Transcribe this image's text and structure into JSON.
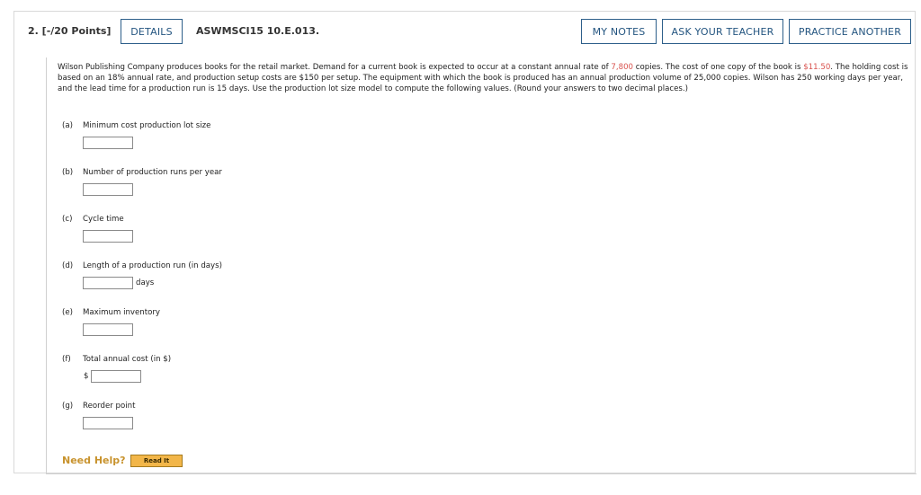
{
  "header": {
    "question_number": "2. [-/20 Points]",
    "details_button": "DETAILS",
    "problem_code": "ASWMSCI15 10.E.013.",
    "my_notes_button": "MY NOTES",
    "ask_teacher_button": "ASK YOUR TEACHER",
    "practice_another_button": "PRACTICE ANOTHER"
  },
  "problem": {
    "text_1": "Wilson Publishing Company produces books for the retail market. Demand for a current book is expected to occur at a constant annual rate of ",
    "demand_value": "7,800",
    "text_2": " copies. The cost of one copy of the book is ",
    "cost_value": "$11.50",
    "text_3": ". The holding cost is based on an 18% annual rate, and production setup costs are $150 per setup. The equipment with which the book is produced has an annual production volume of 25,000 copies. Wilson has 250 working days per year, and the lead time for a production run is 15 days. Use the production lot size model to compute the following values. (Round your answers to two decimal places.)"
  },
  "parts": [
    {
      "letter": "(a)",
      "label": "Minimum cost production lot size",
      "value": ""
    },
    {
      "letter": "(b)",
      "label": "Number of production runs per year",
      "value": ""
    },
    {
      "letter": "(c)",
      "label": "Cycle time",
      "value": ""
    },
    {
      "letter": "(d)",
      "label": "Length of a production run (in days)",
      "value": "",
      "unit": "days"
    },
    {
      "letter": "(e)",
      "label": "Maximum inventory",
      "value": ""
    },
    {
      "letter": "(f)",
      "label": "Total annual cost (in $)",
      "value": "",
      "prefix": "$"
    },
    {
      "letter": "(g)",
      "label": "Reorder point",
      "value": ""
    }
  ],
  "help": {
    "need_help": "Need Help?",
    "read_it_button": "Read It"
  },
  "colors": {
    "accent": "#245580",
    "highlight_value": "#d9534f",
    "need_help": "#c8932e",
    "read_it_bg": "#f2b649"
  }
}
